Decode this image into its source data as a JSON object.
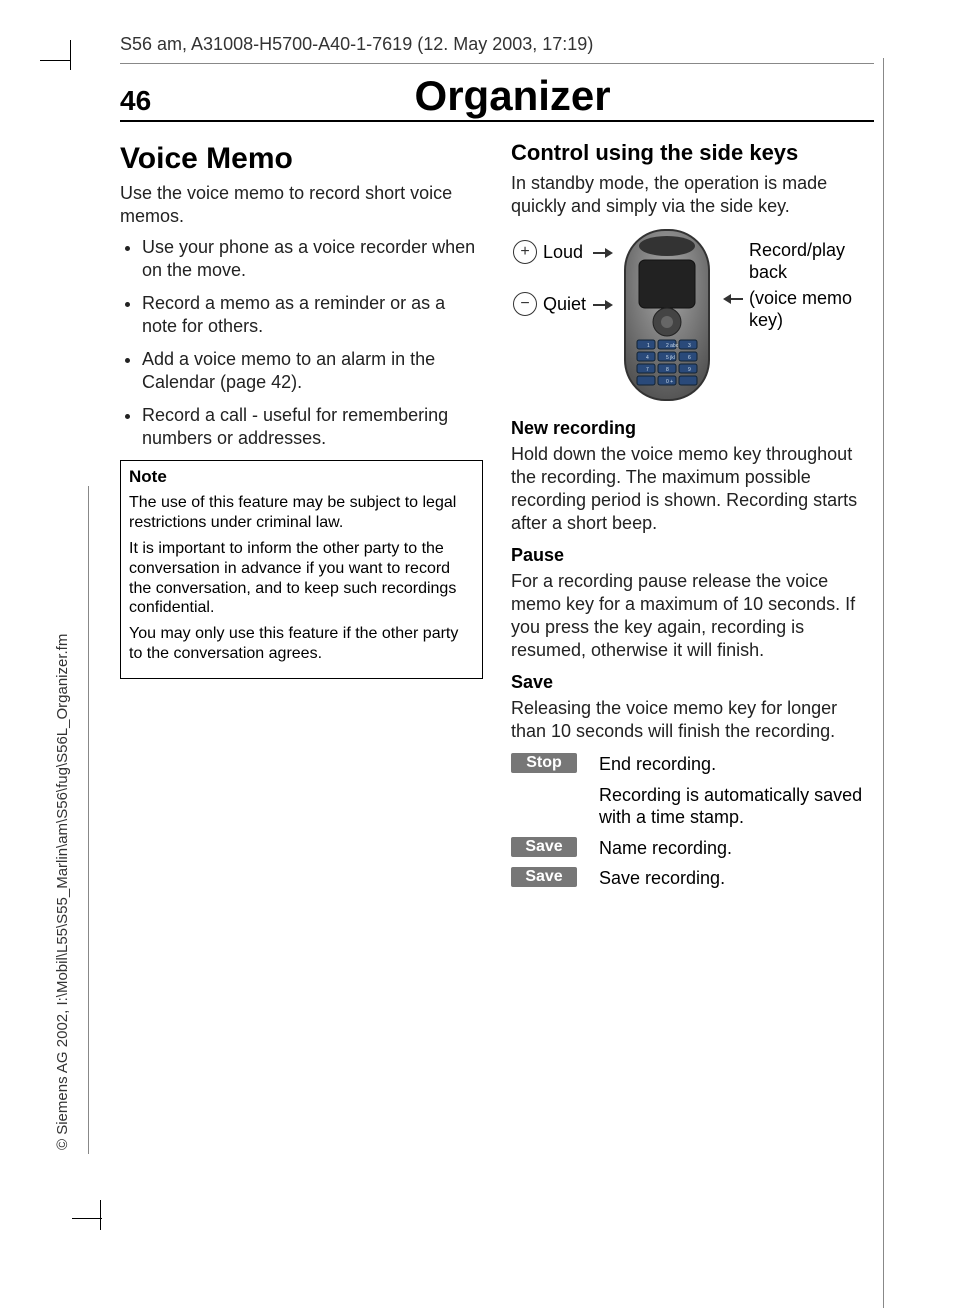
{
  "doc_header": "S56 am, A31008-H5700-A40-1-7619 (12. May 2003, 17:19)",
  "page_number": "46",
  "chapter_title": "Organizer",
  "side_copyright": "© Siemens AG 2002, I:\\Mobil\\L55\\S55_Marlin\\am\\S56\\fug\\S56L_Organizer.fm",
  "left": {
    "h1": "Voice Memo",
    "intro": "Use the voice memo to record short voice memos.",
    "bullets": [
      "Use your phone as a voice recorder when on the move.",
      "Record a memo as a reminder or as a note for others.",
      "Add a voice memo to an alarm in the Calendar (page 42).",
      "Record a call - useful for remembering numbers or addresses."
    ],
    "note_title": "Note",
    "note_p1": "The use of this feature may be subject to legal restrictions under criminal law.",
    "note_p2": "It is important to inform the other party to the conversation in advance if you want to record the conversation, and to keep such recordings confidential.",
    "note_p3": "You may only use this feature if the other party to the conversation agrees."
  },
  "right": {
    "h2": "Control using the side keys",
    "intro": "In standby mode, the operation is made quickly and simply via the side key.",
    "diagram": {
      "loud_label": "Loud",
      "quiet_label": "Quiet",
      "right_label_1": "Record/play back",
      "right_label_2": "(voice memo key)"
    },
    "new_recording_h": "New recording",
    "new_recording_p": "Hold down the voice memo key throughout the recording. The maximum possible recording period is shown. Recording starts after a short beep.",
    "pause_h": "Pause",
    "pause_p": "For a recording pause release the voice memo key for a maximum of 10 seconds. If you press the key again, recording is resumed, otherwise it will finish.",
    "save_h": "Save",
    "save_p": "Releasing the voice memo key for longer than 10 seconds will finish the recording.",
    "actions": [
      {
        "btn": "Stop",
        "desc": "End recording."
      },
      {
        "btn": "",
        "desc": "Recording is automatically saved with a time stamp."
      },
      {
        "btn": "Save",
        "desc": "Name recording."
      },
      {
        "btn": "Save",
        "desc": "Save recording."
      }
    ]
  }
}
